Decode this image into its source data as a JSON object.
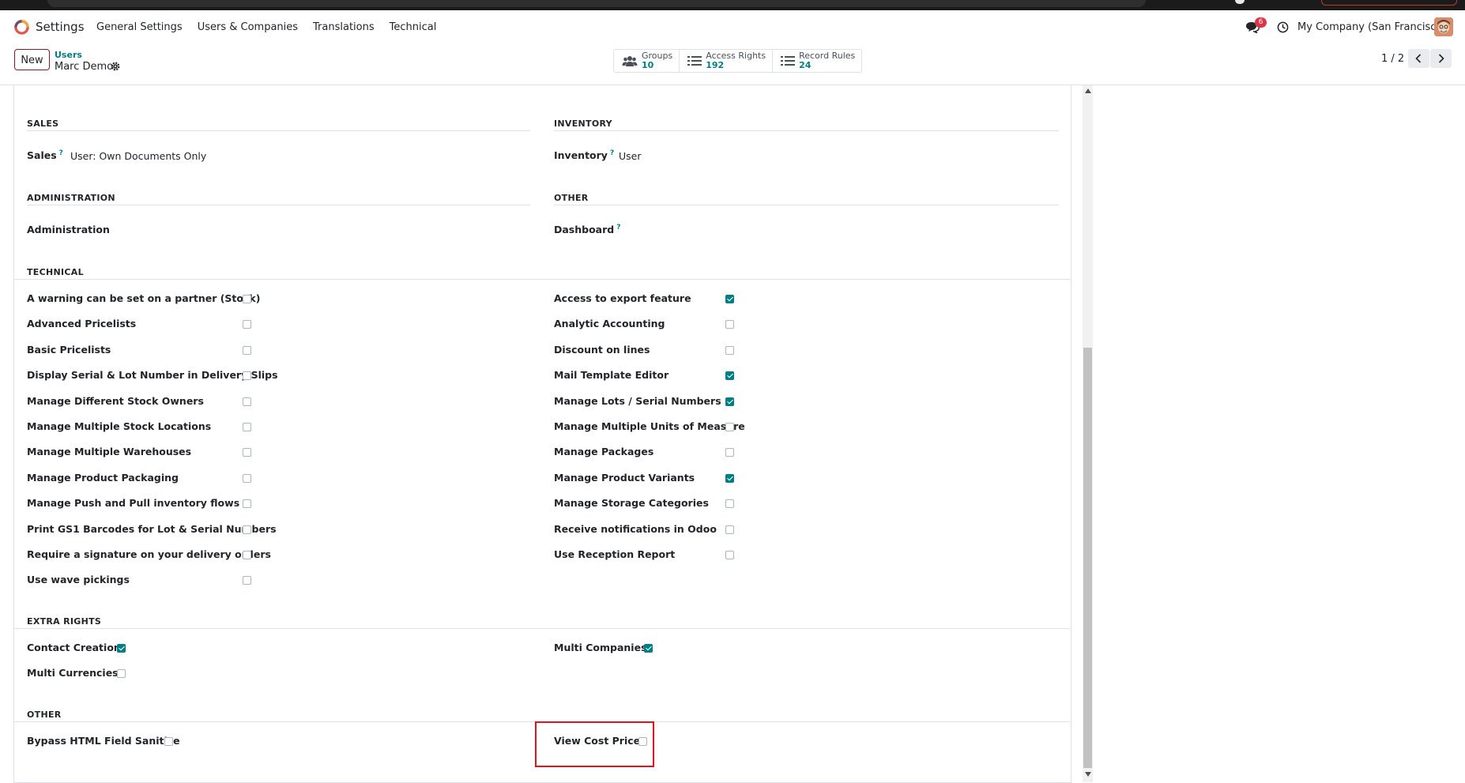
{
  "nav": {
    "app_name": "Settings",
    "menu": [
      "General Settings",
      "Users & Companies",
      "Translations",
      "Technical"
    ],
    "message_count": "6",
    "company": "My Company (San Francisco)"
  },
  "control": {
    "new_label": "New",
    "breadcrumb_parent": "Users",
    "breadcrumb_current": "Marc Demo",
    "stats": [
      {
        "label": "Groups",
        "value": "10"
      },
      {
        "label": "Access Rights",
        "value": "192"
      },
      {
        "label": "Record Rules",
        "value": "24"
      }
    ],
    "pager": "1 / 2"
  },
  "sections": {
    "sales": {
      "title": "SALES",
      "label": "Sales",
      "help": "?",
      "value": "User: Own Documents Only"
    },
    "inventory": {
      "title": "INVENTORY",
      "label": "Inventory",
      "help": "?",
      "value": "User"
    },
    "administration": {
      "title": "ADMINISTRATION",
      "label": "Administration"
    },
    "other_top": {
      "title": "OTHER",
      "label": "Dashboard",
      "help": "?"
    },
    "technical": {
      "title": "TECHNICAL",
      "left": [
        {
          "label": "A warning can be set on a partner (Stock)",
          "checked": false
        },
        {
          "label": "Advanced Pricelists",
          "checked": false
        },
        {
          "label": "Basic Pricelists",
          "checked": false
        },
        {
          "label": "Display Serial & Lot Number in Delivery Slips",
          "checked": false
        },
        {
          "label": "Manage Different Stock Owners",
          "checked": false
        },
        {
          "label": "Manage Multiple Stock Locations",
          "checked": false
        },
        {
          "label": "Manage Multiple Warehouses",
          "checked": false
        },
        {
          "label": "Manage Product Packaging",
          "checked": false
        },
        {
          "label": "Manage Push and Pull inventory flows",
          "checked": false
        },
        {
          "label": "Print GS1 Barcodes for Lot & Serial Numbers",
          "checked": false
        },
        {
          "label": "Require a signature on your delivery orders",
          "checked": false
        },
        {
          "label": "Use wave pickings",
          "checked": false
        }
      ],
      "right": [
        {
          "label": "Access to export feature",
          "checked": true
        },
        {
          "label": "Analytic Accounting",
          "checked": false
        },
        {
          "label": "Discount on lines",
          "checked": false
        },
        {
          "label": "Mail Template Editor",
          "checked": true
        },
        {
          "label": "Manage Lots / Serial Numbers",
          "checked": true
        },
        {
          "label": "Manage Multiple Units of Measure",
          "checked": false
        },
        {
          "label": "Manage Packages",
          "checked": false
        },
        {
          "label": "Manage Product Variants",
          "checked": true
        },
        {
          "label": "Manage Storage Categories",
          "checked": false
        },
        {
          "label": "Receive notifications in Odoo",
          "checked": false
        },
        {
          "label": "Use Reception Report",
          "checked": false
        }
      ]
    },
    "extra": {
      "title": "EXTRA RIGHTS",
      "left": [
        {
          "label": "Contact Creation",
          "checked": true
        },
        {
          "label": "Multi Currencies",
          "checked": false
        }
      ],
      "right": [
        {
          "label": "Multi Companies",
          "checked": true
        }
      ]
    },
    "other_bottom": {
      "title": "OTHER",
      "left": [
        {
          "label": "Bypass HTML Field Sanitize",
          "checked": false
        }
      ],
      "right": [
        {
          "label": "View Cost Price",
          "checked": false
        }
      ]
    }
  },
  "colors": {
    "accent": "#017e84",
    "brand": "#714b67",
    "highlight": "#e0141e"
  }
}
